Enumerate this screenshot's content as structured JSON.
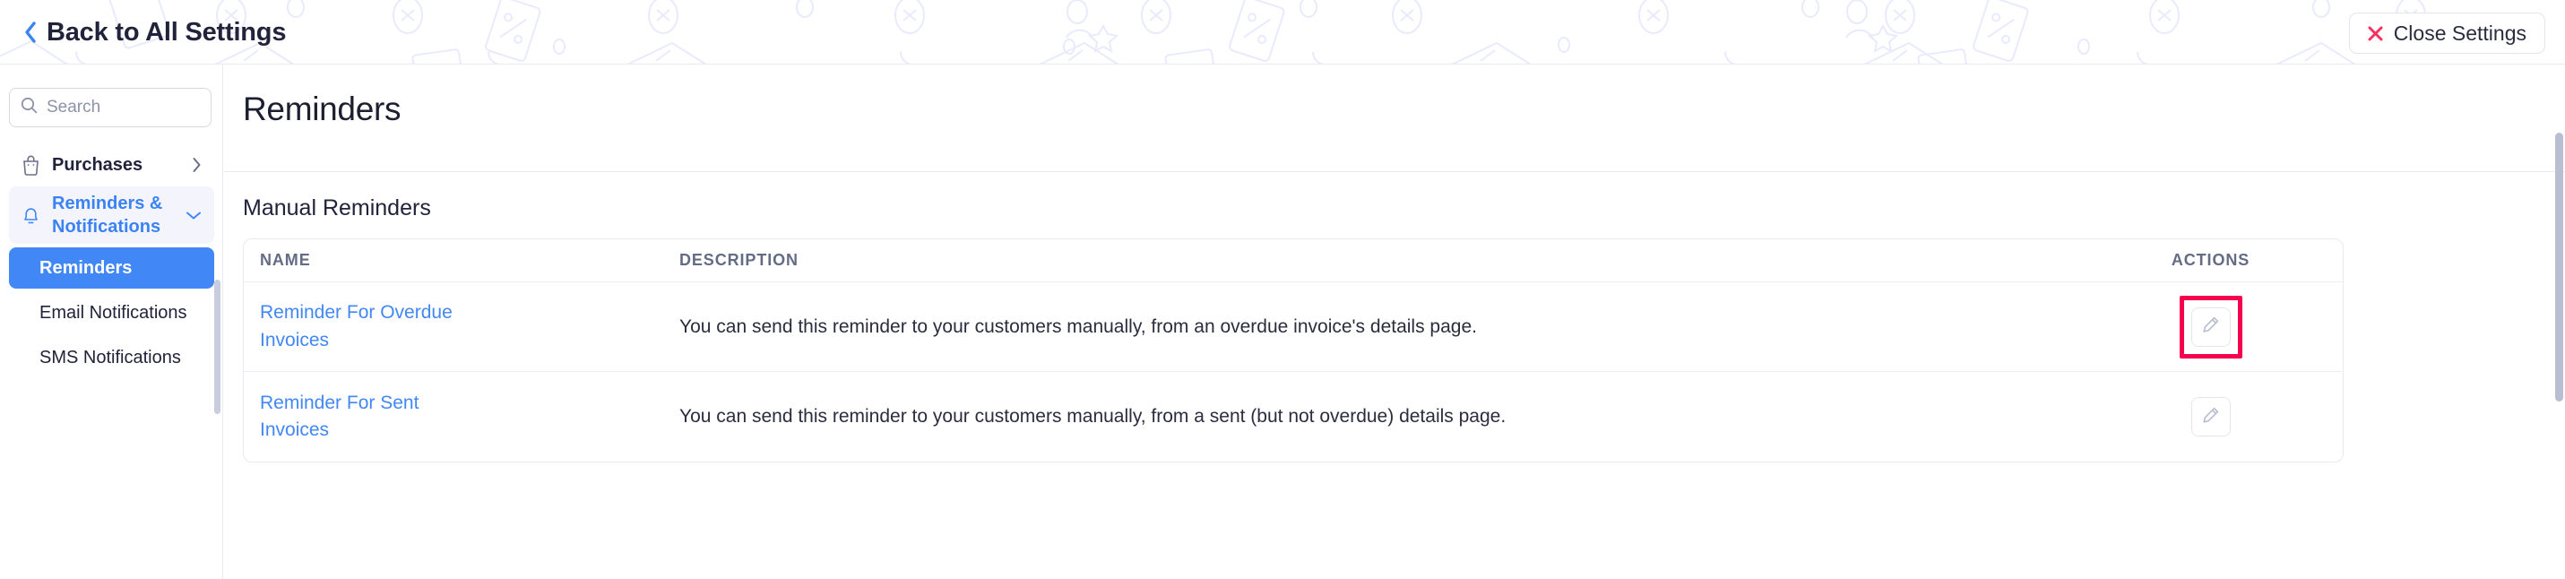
{
  "topbar": {
    "back_label": "Back to All Settings",
    "back_icon": "chevron-left-icon",
    "close_label": "Close Settings",
    "close_icon": "close-x-icon",
    "accent_blue": "#3b82f6",
    "close_red": "#f5325f"
  },
  "sidebar": {
    "search": {
      "value": "",
      "placeholder": "Search",
      "icon": "search-icon"
    },
    "groups": [
      {
        "label": "Purchases",
        "icon": "shopping-bag-icon",
        "chevron": "chevron-right-icon",
        "active": false
      },
      {
        "label": "Reminders & Notifications",
        "icon": "bell-icon",
        "chevron": "chevron-down-icon",
        "active": true
      }
    ],
    "sub_items": [
      {
        "label": "Reminders",
        "selected": true
      },
      {
        "label": "Email Notifications",
        "selected": false
      },
      {
        "label": "SMS Notifications",
        "selected": false
      }
    ],
    "selected_bg": "#4187f5"
  },
  "main": {
    "page_title": "Reminders",
    "section_title": "Manual Reminders",
    "table": {
      "columns": [
        "NAME",
        "DESCRIPTION",
        "ACTIONS"
      ],
      "rows": [
        {
          "name": "Reminder For Overdue Invoices",
          "description": "You can send this reminder to your customers manually, from an overdue invoice's details page.",
          "action_icon": "pencil-edit-icon",
          "highlighted": true
        },
        {
          "name": "Reminder For Sent Invoices",
          "description": "You can send this reminder to your customers manually, from a sent (but not overdue) details page.",
          "action_icon": "pencil-edit-icon",
          "highlighted": false
        }
      ]
    },
    "highlight_color": "#f5004f",
    "link_color": "#4187f5"
  }
}
